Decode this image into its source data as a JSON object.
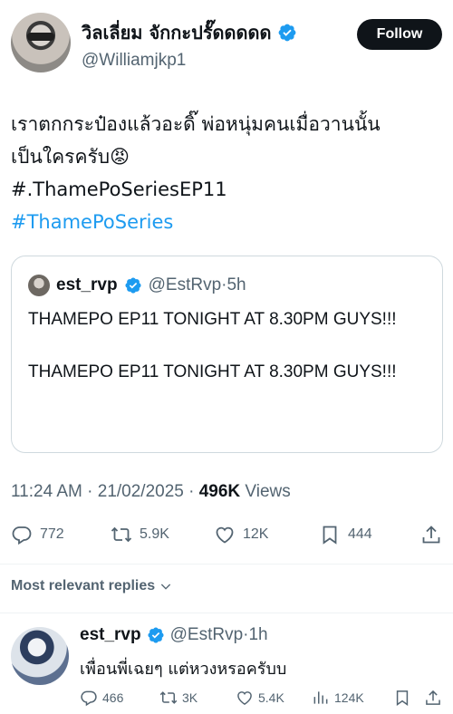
{
  "author": {
    "display_name": "วิลเลี่ยม จักกะปรั๊ดดดดด",
    "handle": "@Williamjkp1",
    "follow_label": "Follow"
  },
  "tweet": {
    "lines": [
      "เราตกกระป๋องแล้วอะดิ๊ พ่อหนุ่มคนเมื่อวานนั้น",
      "เป็นใครครับ😡",
      "#.ThamePoSeriesEP11",
      "#ThamePoSeries"
    ]
  },
  "quote": {
    "name": "est_rvp",
    "meta": "@EstRvp·5h",
    "paragraphs": [
      "THAMEPO EP11 TONIGHT AT 8.30PM GUYS!!!",
      "THAMEPO EP11 TONIGHT AT 8.30PM GUYS!!!"
    ]
  },
  "timestamp": {
    "date": "11:24 AM · 21/02/2025 · ",
    "views_count": "496K",
    "views_label": " Views"
  },
  "actions": {
    "replies": "772",
    "reposts": "5.9K",
    "likes": "12K",
    "bookmarks": "444"
  },
  "relevant_label": "Most relevant replies",
  "reply": {
    "name": "est_rvp",
    "meta": "@EstRvp·1h",
    "text": "เพื่อนพี่เฉยๆ แต่หวงหรอครับบ",
    "replies": "466",
    "reposts": "3K",
    "likes": "5.4K",
    "views": "124K"
  },
  "colors": {
    "verified": "#1d9bf0",
    "hashtag": "#1d9bf0",
    "secondary_text": "#536471"
  }
}
